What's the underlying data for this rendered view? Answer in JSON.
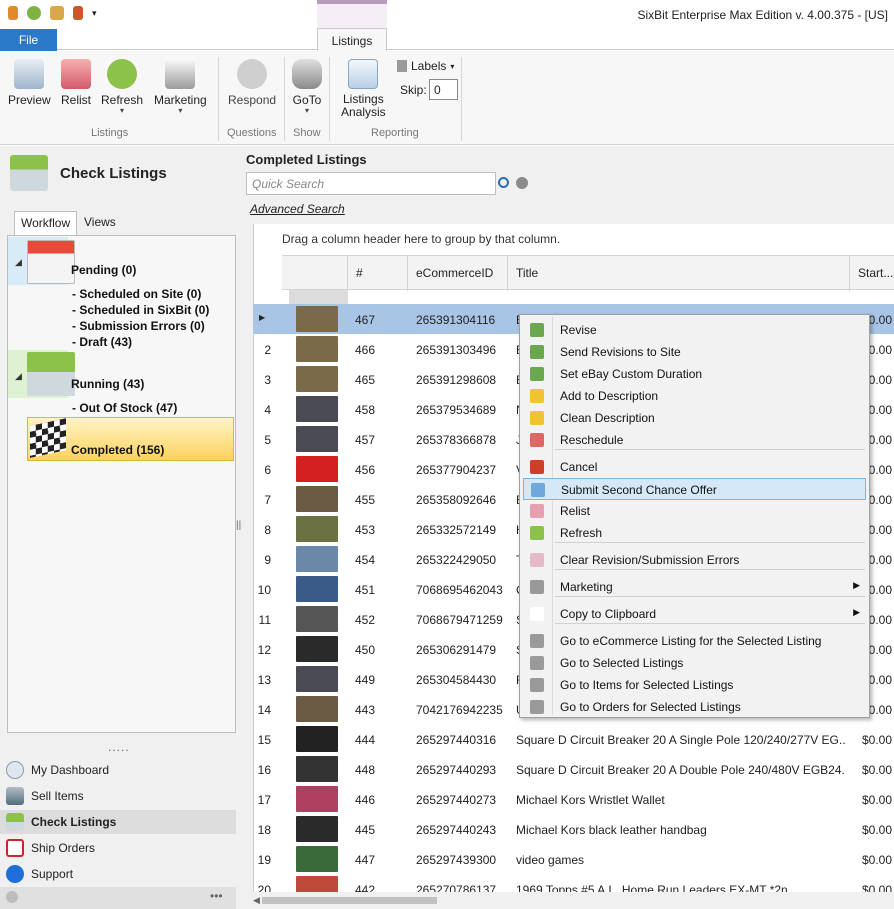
{
  "app": {
    "title": "SixBit Enterprise Max Edition v. 4.00.375 - [US]"
  },
  "ribbon": {
    "file_tab": "File",
    "listings_tab": "Listings",
    "buttons": {
      "preview": "Preview",
      "relist": "Relist",
      "refresh": "Refresh",
      "marketing": "Marketing",
      "respond": "Respond",
      "goto": "GoTo",
      "listings_analysis_1": "Listings",
      "listings_analysis_2": "Analysis",
      "labels": "Labels",
      "skip_label": "Skip:",
      "skip_value": "0"
    },
    "groups": {
      "listings": "Listings",
      "questions": "Questions",
      "show": "Show",
      "reporting": "Reporting"
    }
  },
  "left": {
    "title": "Check Listings",
    "tabs": {
      "workflow": "Workflow",
      "views": "Views"
    },
    "tree": {
      "pending": "Pending (0)",
      "pending_subs": [
        "- Scheduled on Site (0)",
        "- Scheduled in SixBit (0)",
        "- Submission Errors (0)",
        "- Draft (43)"
      ],
      "running": "Running (43)",
      "running_subs": [
        "- Out Of Stock (47)"
      ],
      "completed": "Completed (156)"
    },
    "nav": [
      "My Dashboard",
      "Sell Items",
      "Check Listings",
      "Ship Orders",
      "Support"
    ],
    "dots": "....."
  },
  "main": {
    "title": "Completed Listings",
    "search_placeholder": "Quick Search",
    "advanced": "Advanced Search",
    "drag_hint": "Drag a column header here to group by that column.",
    "columns": {
      "num": "#",
      "ecom": "eCommerceID",
      "title": "Title",
      "start": "Start..."
    },
    "rows": [
      {
        "n": "",
        "id": "467",
        "eid": "265391304116",
        "title": "E",
        "start": "$0.00",
        "thumb": "#7a6a4a"
      },
      {
        "n": "2",
        "id": "466",
        "eid": "265391303496",
        "title": "E",
        "start": "$0.00",
        "thumb": "#7a6a4a"
      },
      {
        "n": "3",
        "id": "465",
        "eid": "265391298608",
        "title": "E",
        "start": "$0.00",
        "thumb": "#7a6a4a"
      },
      {
        "n": "4",
        "id": "458",
        "eid": "265379534689",
        "title": "N",
        "start": "$0.00",
        "thumb": "#4a4a55"
      },
      {
        "n": "5",
        "id": "457",
        "eid": "265378366878",
        "title": "J",
        "start": "$0.00",
        "thumb": "#4a4a55"
      },
      {
        "n": "6",
        "id": "456",
        "eid": "265377904237",
        "title": "V",
        "start": "$0.00",
        "thumb": "#d42020"
      },
      {
        "n": "7",
        "id": "455",
        "eid": "265358092646",
        "title": "E",
        "start": "$0.00",
        "thumb": "#6b5a44"
      },
      {
        "n": "8",
        "id": "453",
        "eid": "265332572149",
        "title": "H",
        "start": "$0.00",
        "thumb": "#6b7040"
      },
      {
        "n": "9",
        "id": "454",
        "eid": "265322429050",
        "title": "T",
        "start": "$0.00",
        "thumb": "#6a88a8"
      },
      {
        "n": "10",
        "id": "451",
        "eid": "7068695462043",
        "title": "C",
        "start": "$0.00",
        "thumb": "#3a5a88"
      },
      {
        "n": "11",
        "id": "452",
        "eid": "7068679471259",
        "title": "S",
        "start": "$0.00",
        "thumb": "#555555"
      },
      {
        "n": "12",
        "id": "450",
        "eid": "265306291479",
        "title": "S",
        "start": "$0.00",
        "thumb": "#2a2a2a"
      },
      {
        "n": "13",
        "id": "449",
        "eid": "265304584430",
        "title": "F",
        "start": "$0.00",
        "thumb": "#4a4a55"
      },
      {
        "n": "14",
        "id": "443",
        "eid": "7042176942235",
        "title": "U",
        "start": "$0.00",
        "thumb": "#6b5a44"
      },
      {
        "n": "15",
        "id": "444",
        "eid": "265297440316",
        "title": "Square D Circuit Breaker 20 A Single Pole 120/240/277V EG...",
        "start": "$0.00",
        "thumb": "#222222"
      },
      {
        "n": "16",
        "id": "448",
        "eid": "265297440293",
        "title": "Square D Circuit Breaker 20 A Double Pole 240/480V EGB24...",
        "start": "$0.00",
        "thumb": "#333333"
      },
      {
        "n": "17",
        "id": "446",
        "eid": "265297440273",
        "title": "Michael Kors Wristlet Wallet",
        "start": "$0.00",
        "thumb": "#b04060"
      },
      {
        "n": "18",
        "id": "445",
        "eid": "265297440243",
        "title": "Michael Kors black leather handbag",
        "start": "$0.00",
        "thumb": "#2a2a2a"
      },
      {
        "n": "19",
        "id": "447",
        "eid": "265297439300",
        "title": "video games",
        "start": "$0.00",
        "thumb": "#3a6a3a"
      },
      {
        "n": "20",
        "id": "442",
        "eid": "265270786137",
        "title": "1969 Topps #5 A.L. Home Run Leaders EX-MT *2n",
        "start": "$0.00",
        "thumb": "#c04a3a"
      }
    ]
  },
  "context_menu": {
    "items": [
      "Revise",
      "Send Revisions to Site",
      "Set eBay Custom Duration",
      "Add to Description",
      "Clean Description",
      "Reschedule",
      "Cancel",
      "Submit Second Chance Offer",
      "Relist",
      "Refresh",
      "Clear Revision/Submission Errors",
      "Marketing",
      "Copy to Clipboard",
      "Go to eCommerce Listing for the Selected Listing",
      "Go to Selected Listings",
      "Go to Items for Selected Listings",
      "Go to Orders for Selected Listings"
    ]
  },
  "colors": {
    "file_tab": "#2b79c9",
    "selected_row": "#a9c5e6",
    "completed_node": "#fbd35e",
    "menu_highlight": "#d5e8f8"
  }
}
